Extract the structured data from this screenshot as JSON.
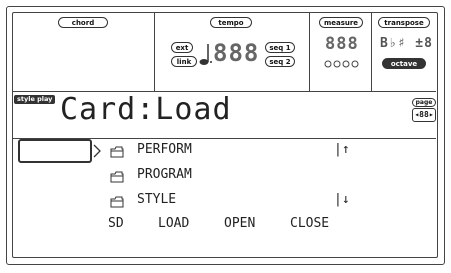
{
  "header": {
    "chord_label": "chord",
    "tempo_label": "tempo",
    "tempo_ext": "ext",
    "tempo_link": "link",
    "tempo_seq1": "seq 1",
    "tempo_seq2": "seq 2",
    "tempo_digits": "888",
    "measure_label": "measure",
    "measure_digits": "888",
    "transpose_label": "transpose",
    "transpose_value": "B♭♯ ±8",
    "octave_label": "octave"
  },
  "page": {
    "mode_tag": "style play",
    "title": "Card:Load",
    "page_label": "page",
    "page_digits": "88"
  },
  "files": {
    "items": [
      {
        "name": "PERFORM"
      },
      {
        "name": "PROGRAM"
      },
      {
        "name": "STYLE"
      }
    ],
    "scroll_up": "↑",
    "scroll_down": "↓"
  },
  "footer": {
    "device": "SD",
    "load": "LOAD",
    "open": "OPEN",
    "close": "CLOSE"
  }
}
